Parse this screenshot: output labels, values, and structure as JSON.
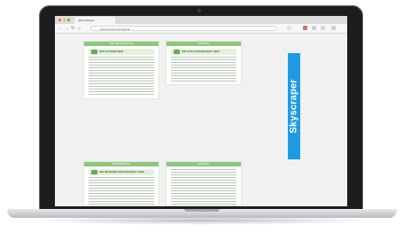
{
  "browser": {
    "tab_title": "Jobst Scraper",
    "address": "www.example-domain.de"
  },
  "ad": {
    "label": "Skyscraper",
    "color": "#1e9be0"
  },
  "panels": [
    {
      "header": "ERSTE SCHRITTE",
      "banner": "WIR SUCHEN HIER"
    },
    {
      "header": "SERVICE",
      "banner": "IHR STELLENANGEBOT HIER"
    },
    {
      "header": "BEWERBUNG",
      "banner": "IHR BEWERBUNGSANGEBOT HIER"
    },
    {
      "header": "KONTAKT",
      "banner": ""
    }
  ]
}
